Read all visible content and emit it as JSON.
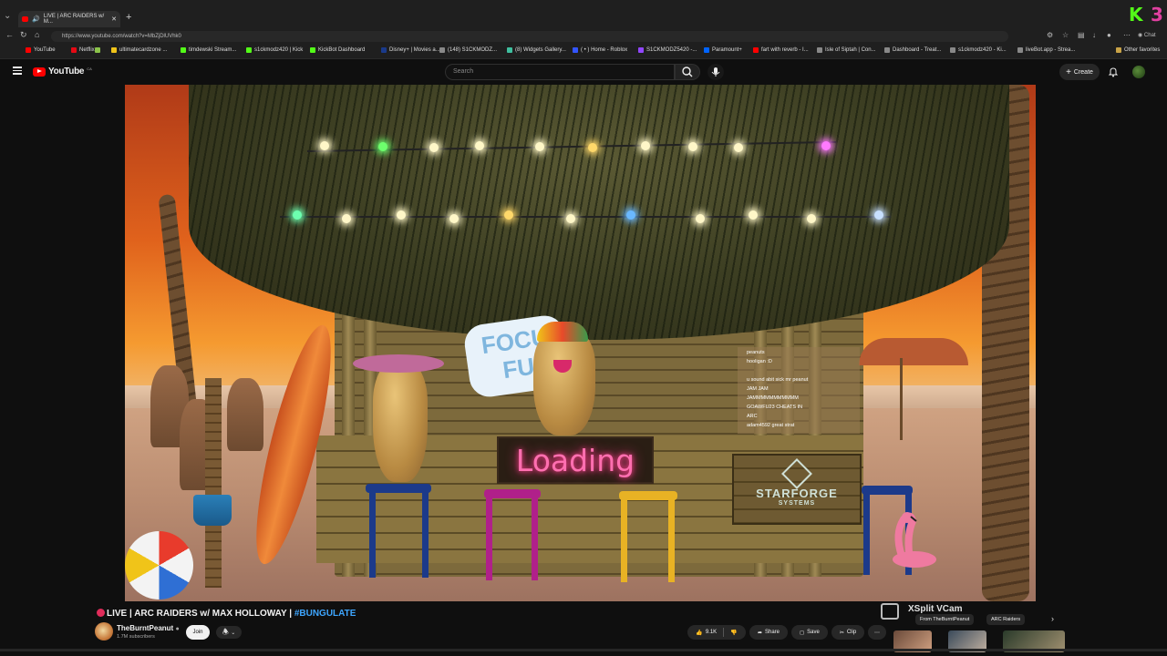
{
  "browser": {
    "tab_title": "LIVE | ARC RAIDERS w/ M...",
    "url": "https://www.youtube.com/watch?v=MbZjDlUVhk0",
    "chat_label": "Chat",
    "bookmarks": [
      {
        "label": "YouTube",
        "color": "#ff0000"
      },
      {
        "label": "Netflix",
        "color": "#e50914"
      },
      {
        "label": "",
        "color": "#8bc34a"
      },
      {
        "label": "ultimatecardzone ...",
        "color": "#f0c419"
      },
      {
        "label": "timdewski Stream...",
        "color": "#53fc18"
      },
      {
        "label": "s1ckmodz420 | Kick",
        "color": "#53fc18"
      },
      {
        "label": "KickBot Dashboard",
        "color": "#53fc18"
      },
      {
        "label": "Disney+ | Movies a...",
        "color": "#1a3a8a"
      },
      {
        "label": "(148) S1CKMODZ...",
        "color": "#888888"
      },
      {
        "label": "(8) Widgets Gallery...",
        "color": "#3fbf9f"
      },
      {
        "label": "( • ) Home - Roblox",
        "color": "#3355ff"
      },
      {
        "label": "S1CKMODZ5420 -...",
        "color": "#9146ff"
      },
      {
        "label": "Paramount+",
        "color": "#0064ff"
      },
      {
        "label": "fart with reverb - I...",
        "color": "#ff0000"
      },
      {
        "label": "Isle of Siptah | Con...",
        "color": "#888888"
      },
      {
        "label": "Dashboard - Treat...",
        "color": "#888888"
      },
      {
        "label": "s1ckmodz420 - Ki...",
        "color": "#888888"
      },
      {
        "label": "liveBot.app - Strea...",
        "color": "#888888"
      }
    ],
    "other_favorites": "Other favorites"
  },
  "youtube": {
    "logo_text": "YouTube",
    "country_code": "CA",
    "search_placeholder": "Search",
    "create_label": "Create"
  },
  "scene": {
    "focus_sign": "FOCU FU",
    "loading_sign": "Loading",
    "starforge_title": "STARFORGE",
    "starforge_sub": "SYSTEMS",
    "chat_lines": [
      "peanuts",
      "hooligan :D",
      "",
      "u sound abit sick mr peanut",
      "JAM JAM",
      "JAMMMMMMMMMMM",
      "GOAWFU23 CHEATS IN",
      "ARC",
      "adam4592  great strat"
    ]
  },
  "video": {
    "live_prefix": "LIVE | ARC RAIDERS w/ MAX HOLLOWAY | ",
    "hashtag": "#BUNGULATE",
    "channel_name": "TheBurntPeanut",
    "subscribers": "1.7M subscribers",
    "join_label": "Join",
    "likes": "9.1K",
    "share_label": "Share",
    "save_label": "Save",
    "clip_label": "Clip"
  },
  "overlay": {
    "xsplit_label": "XSplit VCam"
  },
  "chips": [
    {
      "label": "From TheBurntPeanut",
      "active": false
    },
    {
      "label": "ARC Raiders",
      "active": false
    }
  ],
  "colors": {
    "accent_red": "#ff0000",
    "link_blue": "#3ea6ff",
    "live_dot": "#e02c5a",
    "neon_pink": "#ff6fb0",
    "kick_green": "#53fc18",
    "kick_pink": "#e040a0"
  }
}
